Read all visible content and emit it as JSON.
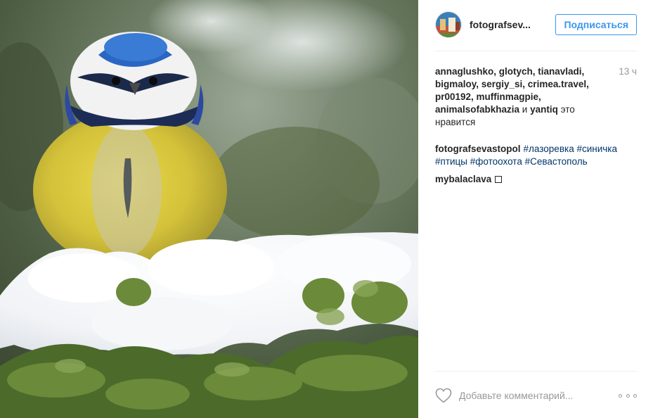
{
  "post": {
    "image_alt": "Blue tit on snowy conifer branch",
    "header": {
      "username": "fotografsev...",
      "follow_label": "Подписаться"
    },
    "likes": {
      "users_line_1": "annaglushko, glotych, tianavladi,",
      "users_line_2": "bigmaloy, sergiy_si, crimea.travel,",
      "users_line_3": "pr00192, muffinmagpie,",
      "users_line_4": "animalsofabkhazia",
      "conjunction": " и ",
      "last_user": "yantiq",
      "suffix": " это нравится"
    },
    "time_ago": "13 ч",
    "caption": {
      "author": "fotografsevastopol",
      "hashtags": [
        "#лазоревка",
        "#синичка",
        "#птицы",
        "#фотоохота",
        "#Севастополь"
      ]
    },
    "comments": [
      {
        "author": "mybalaclava"
      }
    ],
    "comment_input": {
      "placeholder": "Добавьте комментарий..."
    },
    "icons": {
      "like": "heart-icon",
      "more": "more-options-icon"
    },
    "colors": {
      "link_blue": "#3897f0",
      "hashtag": "#003569",
      "muted": "#999999",
      "text": "#262626"
    }
  }
}
